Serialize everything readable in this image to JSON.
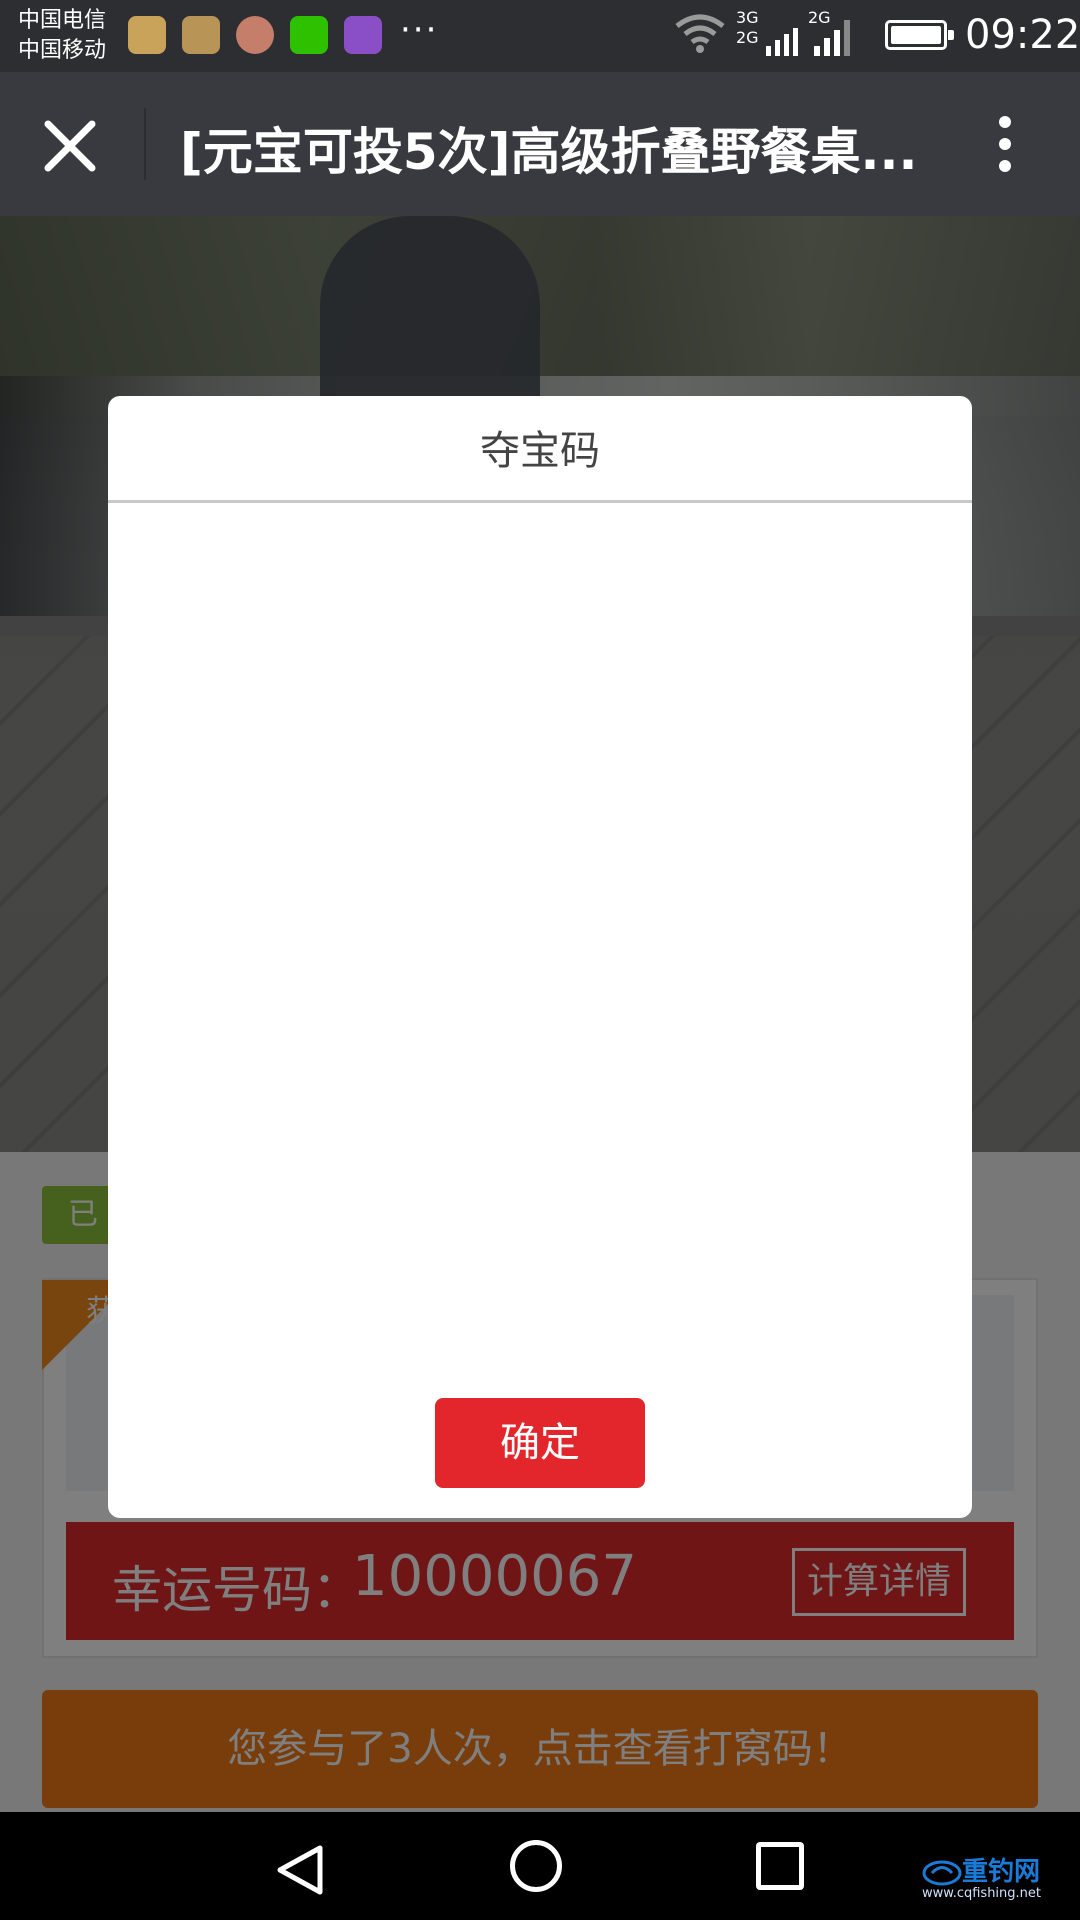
{
  "status_bar": {
    "carrier_1": "中国电信",
    "carrier_2": "中国移动",
    "overflow": "···",
    "sim1_label_top": "3G",
    "sim1_label_bottom": "2G",
    "sim2_label": "2G",
    "time": "09:22",
    "notification_icons": [
      "health-icon",
      "message-icon",
      "avatar-icon",
      "wechat-icon",
      "keyboard-icon"
    ]
  },
  "header": {
    "title": "[元宝可投5次]高级折叠野餐桌..."
  },
  "page": {
    "green_tag": "已",
    "ribbon_text": "获",
    "lucky_label": "幸运号码：",
    "lucky_number": "10000067",
    "calc_button": "计算详情",
    "participation_text": "您参与了3人次，点击查看打窝码！"
  },
  "modal": {
    "title": "夺宝码",
    "confirm_button": "确定"
  },
  "watermark": {
    "brand": "重钓网",
    "url": "www.cqfishing.net"
  },
  "colors": {
    "accent_red": "#e2262c",
    "orange": "#f27b17",
    "green": "#8ac33a",
    "header_bg": "#393a3f"
  }
}
